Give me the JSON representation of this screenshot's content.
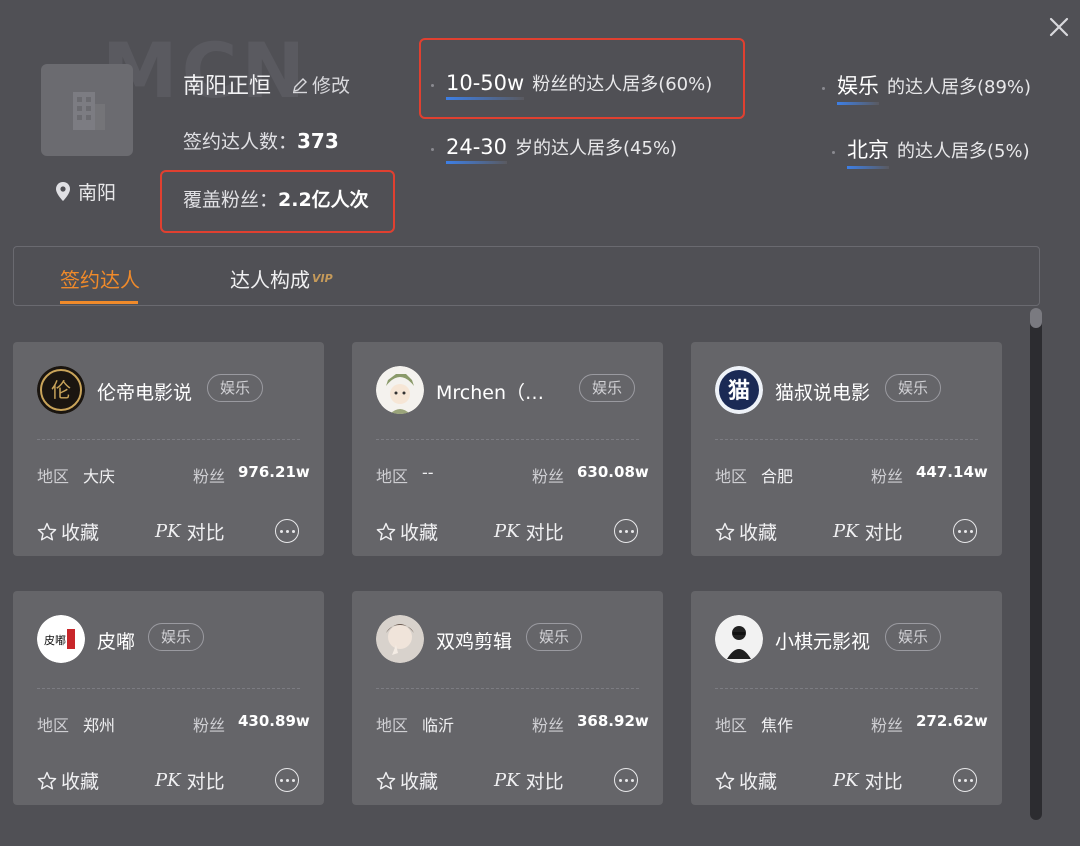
{
  "watermark": "MCN",
  "org": {
    "name": "南阳正恒",
    "edit_label": "修改",
    "signed_label": "签约达人数：",
    "signed_count": "373",
    "fans_label": "覆盖粉丝：",
    "fans_value": "2.2亿人次",
    "location": "南阳"
  },
  "stats": [
    {
      "highlight": "10-50w",
      "text": "粉丝的达人居多(60%)"
    },
    {
      "highlight": "娱乐",
      "text": "的达人居多(89%)"
    },
    {
      "highlight": "24-30",
      "text": "岁的达人居多(45%)"
    },
    {
      "highlight": "北京",
      "text": "的达人居多(5%)"
    }
  ],
  "tabs": [
    {
      "label": "签约达人",
      "active": true
    },
    {
      "label": "达人构成",
      "badge": "VIP"
    }
  ],
  "card_labels": {
    "region": "地区",
    "fans": "粉丝",
    "favorite": "收藏",
    "pk_icon": "PK",
    "compare": "对比"
  },
  "cards": [
    {
      "name": "伦帝电影说",
      "tag": "娱乐",
      "region": "大庆",
      "fans": "976.21w"
    },
    {
      "name": "Mrchen（剪…",
      "tag": "娱乐",
      "region": "--",
      "fans": "630.08w"
    },
    {
      "name": "猫叔说电影",
      "tag": "娱乐",
      "region": "合肥",
      "fans": "447.14w"
    },
    {
      "name": "皮嘟",
      "tag": "娱乐",
      "region": "郑州",
      "fans": "430.89w"
    },
    {
      "name": "双鸡剪辑",
      "tag": "娱乐",
      "region": "临沂",
      "fans": "368.92w"
    },
    {
      "name": "小棋元影视",
      "tag": "娱乐",
      "region": "焦作",
      "fans": "272.62w"
    }
  ],
  "colors": {
    "accent": "#f08a2a",
    "highlight_box": "#e04030",
    "underline": "#3d7fe6"
  }
}
